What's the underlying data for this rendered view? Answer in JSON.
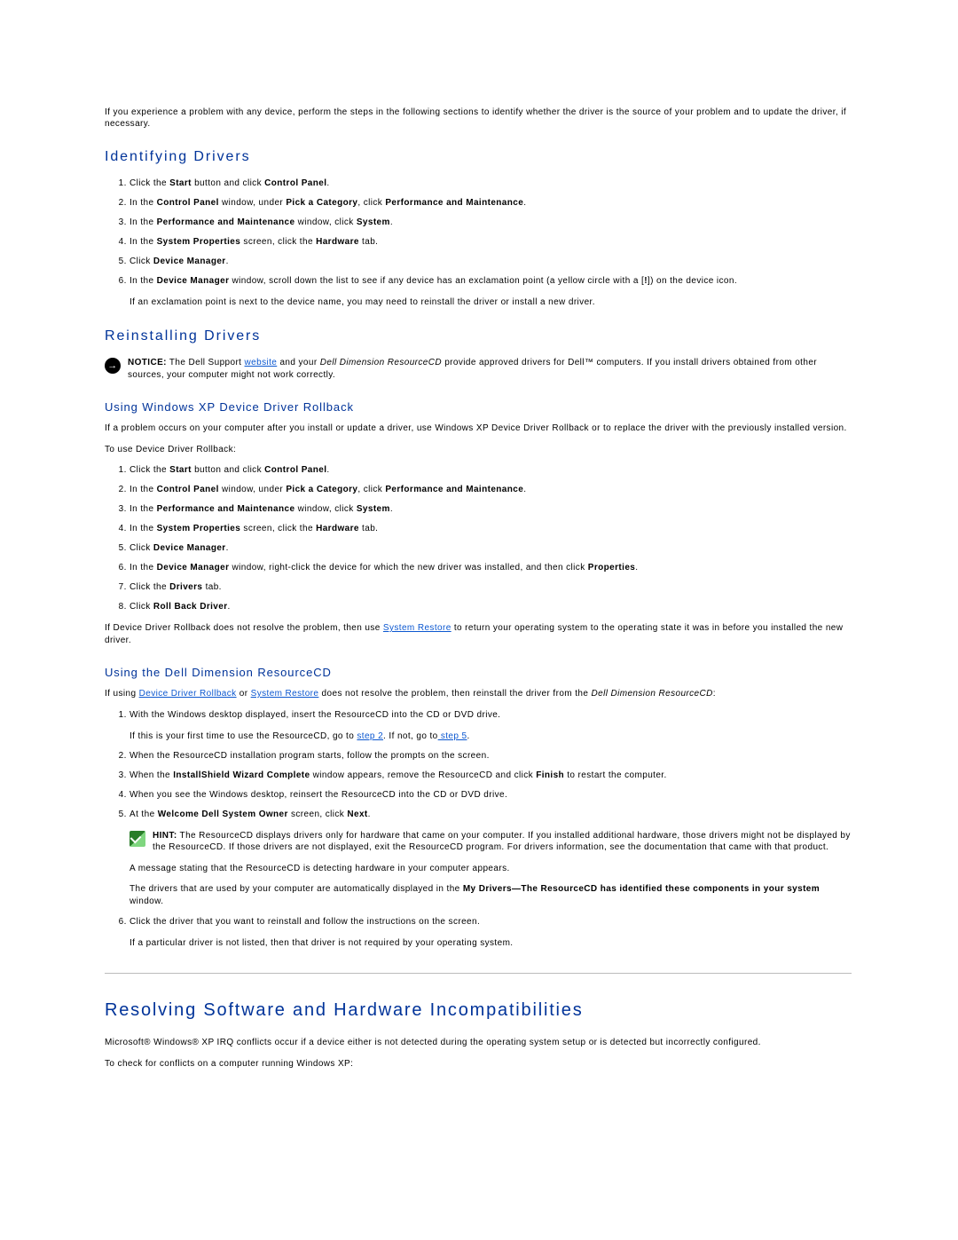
{
  "intro": "If you experience a problem with any device, perform the steps in the following sections to identify whether the driver is the source of your problem and to update the driver, if necessary.",
  "h_identifying": "Identifying Drivers",
  "ident_steps": {
    "s1a": "Click the ",
    "s1b": "Start",
    "s1c": " button and click ",
    "s1d": "Control Panel",
    "s1e": ".",
    "s2a": "In the ",
    "s2b": "Control Panel",
    "s2c": " window, under ",
    "s2d": "Pick a Category",
    "s2e": ", click ",
    "s2f": "Performance and Maintenance",
    "s2g": ".",
    "s3a": "In the ",
    "s3b": "Performance and Maintenance",
    "s3c": " window, click ",
    "s3d": "System",
    "s3e": ".",
    "s4a": "In the ",
    "s4b": "System Properties",
    "s4c": " screen, click the ",
    "s4d": "Hardware",
    "s4e": " tab.",
    "s5a": "Click ",
    "s5b": "Device Manager",
    "s5c": ".",
    "s6a": "In the ",
    "s6b": "Device Manager",
    "s6c": " window, scroll down the list to see if any device has an exclamation point (a yellow circle with a [",
    "s6d": "!",
    "s6e": "]) on the device icon.",
    "s6_follow": "If an exclamation point is next to the device name, you may need to reinstall the driver or install a new driver."
  },
  "h_reinstalling": "Reinstalling Drivers",
  "notice": {
    "lead": "NOTICE:",
    "t1": " The Dell Support ",
    "link": "website",
    "t2": " and your ",
    "em": "Dell Dimension ResourceCD",
    "t3": " provide approved drivers for Dell™ computers. If you install drivers obtained from other sources, your computer might not work correctly."
  },
  "h_rollback": "Using Windows XP Device Driver Rollback",
  "rollback_intro": "If a problem occurs on your computer after you install or update a driver, use Windows XP Device Driver Rollback or to replace the driver with the previously installed version.",
  "rollback_touse": "To use Device Driver Rollback:",
  "rollback_steps": {
    "r6a": "In the ",
    "r6b": "Device Manager",
    "r6c": " window, right-click the device for which the new driver was installed, and then click ",
    "r6d": "Properties",
    "r6e": ".",
    "r7a": "Click the ",
    "r7b": "Drivers",
    "r7c": " tab.",
    "r8a": "Click ",
    "r8b": "Roll Back Driver",
    "r8c": "."
  },
  "rollback_tail": {
    "a": "If Device Driver Rollback does not resolve the problem, then use ",
    "link": "System Restore",
    "b": " to return your operating system to the operating state it was in before you installed the new driver."
  },
  "h_resourcecd": "Using the Dell Dimension ResourceCD",
  "rcd_intro": {
    "a": "If using ",
    "l1": "Device Driver Rollback",
    "b": " or ",
    "l2": "System Restore",
    "c": " does not resolve the problem, then reinstall the driver from the ",
    "em": "Dell Dimension ResourceCD",
    "d": ":"
  },
  "rcd_steps": {
    "s1": "With the Windows desktop displayed, insert the ResourceCD into the CD or DVD drive.",
    "s1fa": "If this is your first time to use the ResourceCD, go to ",
    "s1fl1": "step 2",
    "s1fb": ". If not, go to",
    "s1fl2": " step 5",
    "s1fc": ".",
    "s2": "When the ResourceCD installation program starts, follow the prompts on the screen.",
    "s3a": "When the ",
    "s3b": "InstallShield Wizard Complete",
    "s3c": " window appears, remove the ResourceCD and click ",
    "s3d": "Finish",
    "s3e": " to restart the computer.",
    "s4": "When you see the Windows desktop, reinsert the ResourceCD into the CD or DVD drive.",
    "s5a": "At the ",
    "s5b": "Welcome Dell System Owner",
    "s5c": " screen, click ",
    "s5d": "Next",
    "s5e": "."
  },
  "hint": {
    "lead": "HINT:",
    "text": " The ResourceCD displays drivers only for hardware that came on your computer. If you installed additional hardware, those drivers might not be displayed by the ResourceCD. If those drivers are not displayed, exit the ResourceCD program. For drivers information, see the documentation that came with that product."
  },
  "rcd_after": {
    "p1": "A message stating that the ResourceCD is detecting hardware in your computer appears.",
    "p2a": "The drivers that are used by your computer are automatically displayed in the ",
    "p2b": "My Drivers—The ResourceCD has identified these components in your system",
    "p2c": " window."
  },
  "rcd_step6": {
    "a": "Click the driver that you want to reinstall and follow the instructions on the screen.",
    "b": "If a particular driver is not listed, then that driver is not required by your operating system."
  },
  "h_resolve": "Resolving Software and Hardware Incompatibilities",
  "resolve_p1": "Microsoft® Windows® XP IRQ conflicts occur if a device either is not detected during the operating system setup or is detected but incorrectly configured.",
  "resolve_p2": "To check for conflicts on a computer running Windows XP:"
}
